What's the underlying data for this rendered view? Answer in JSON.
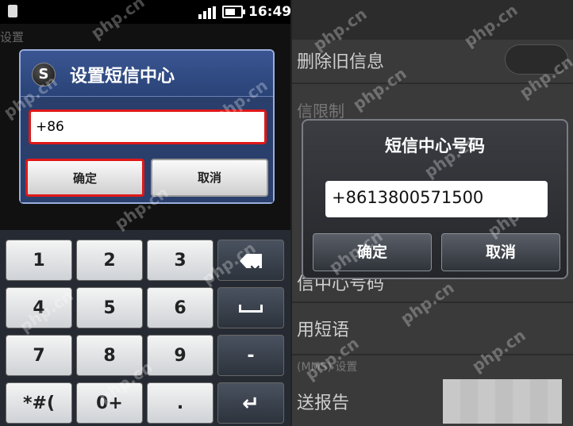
{
  "left_phone": {
    "status_bar": {
      "time": "16:49"
    },
    "background_label": "设置",
    "dialog": {
      "title": "设置短信中心",
      "input_value": "+86",
      "ok_label": "确定",
      "cancel_label": "取消"
    },
    "keypad": {
      "row1": [
        "1",
        "2",
        "3"
      ],
      "row2": [
        "4",
        "5",
        "6"
      ],
      "row3": [
        "7",
        "8",
        "9"
      ],
      "row4": [
        "*#(",
        "0+",
        "."
      ],
      "side_keys": [
        "backspace-icon",
        "space-icon",
        "-",
        "enter-icon"
      ]
    }
  },
  "right_phone": {
    "background_rows": [
      "删除旧信息",
      "信限制",
      "信中心号码",
      "用短语",
      "(MMS) 设置",
      "送报告"
    ],
    "dialog": {
      "title": "短信中心号码",
      "input_value": "+8613800571500",
      "ok_label": "确定",
      "cancel_label": "取消"
    }
  },
  "watermark": "php.cn",
  "colors": {
    "highlight_border": "#e01818",
    "left_dialog": "#2a3f6c",
    "right_dialog": "#2b2d31"
  }
}
